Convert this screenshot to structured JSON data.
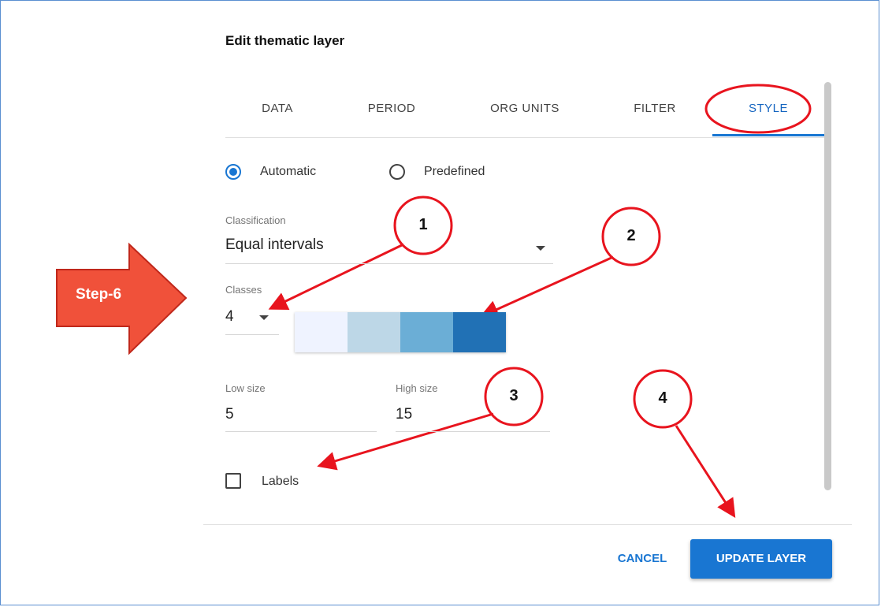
{
  "dialog": {
    "title": "Edit thematic layer",
    "tabs": [
      {
        "label": "DATA"
      },
      {
        "label": "PERIOD"
      },
      {
        "label": "ORG UNITS"
      },
      {
        "label": "FILTER"
      },
      {
        "label": "STYLE",
        "active": true
      }
    ],
    "method": {
      "options": [
        {
          "label": "Automatic",
          "checked": true
        },
        {
          "label": "Predefined",
          "checked": false
        }
      ]
    },
    "classification": {
      "label": "Classification",
      "value": "Equal intervals"
    },
    "classes": {
      "label": "Classes",
      "value": "4"
    },
    "color_scale": [
      "#eff3ff",
      "#bdd7e7",
      "#6baed6",
      "#2171b5"
    ],
    "low_size": {
      "label": "Low size",
      "value": "5"
    },
    "high_size": {
      "label": "High size",
      "value": "15"
    },
    "labels_checkbox": {
      "label": "Labels",
      "checked": false
    },
    "buttons": {
      "cancel": "CANCEL",
      "update": "UPDATE LAYER"
    }
  },
  "annotations": {
    "step_label": "Step-6",
    "callouts": [
      "1",
      "2",
      "3",
      "4"
    ],
    "annotation_color": "#e8141e",
    "step_arrow_color": "#f0513a"
  },
  "colors": {
    "primary": "#1976d2"
  }
}
